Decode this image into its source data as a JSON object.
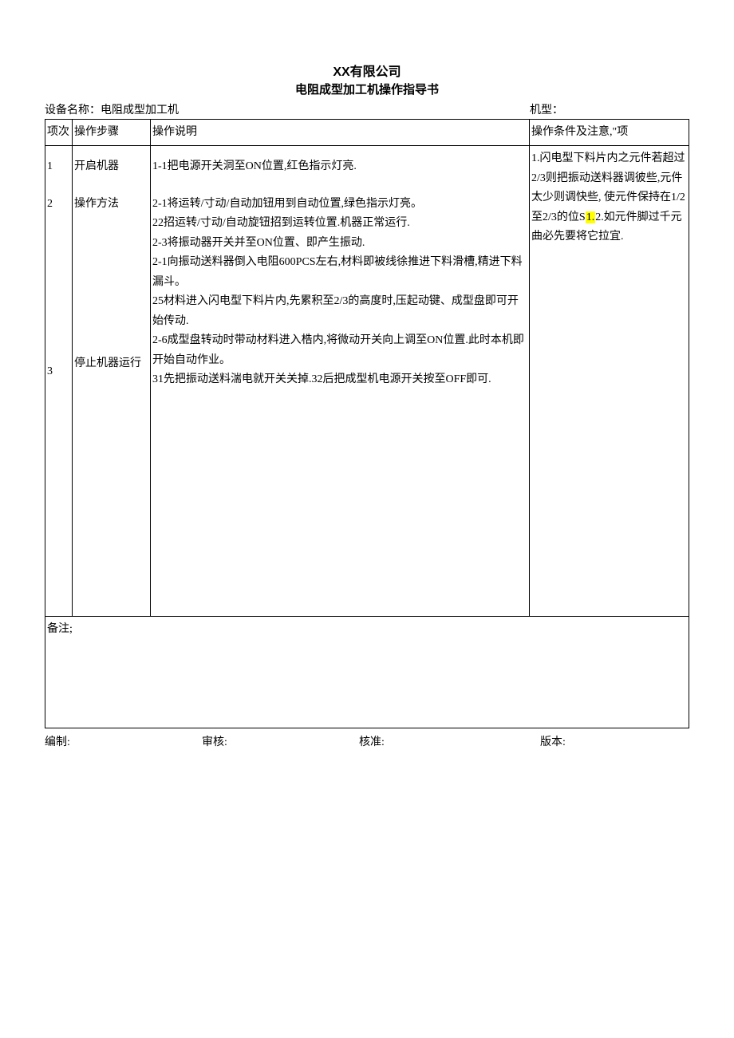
{
  "title": "XX有限公司",
  "subtitle": "电阻成型加工机操作指导书",
  "header": {
    "equip_label": "设备名称：电阻成型加工机",
    "model_label": "机型："
  },
  "columns": {
    "idx": "项次",
    "step": "操作步骤",
    "desc": "操作说明",
    "cond": "操作条件及注意,\"项"
  },
  "rows": [
    {
      "idx": "1",
      "step": "开启机器",
      "desc": "1-1把电源开关洞至ON位置,红色指示灯亮."
    },
    {
      "idx": "2",
      "step": "操作方法",
      "desc": "2-1将运转/寸动/自动加钮用到自动位置,绿色指示灯亮。\n22招运转/寸动/自动旋钮招到运转位置.机器正常运行.\n2-3将振动器开关并至ON位置、即产生振动.\n2-1向振动送料器倒入电阻600PCS左右,材料即被线徐推进下料滑槽,精进下料漏斗。\n25材料进入闪电型下料片内,先累积至2/3的高度时,压起动键、成型盘即可开始传动.\n2-6成型盘转动时带动材料进入梏内,将微动开关向上调至ON位置.此时本机即开始自动作业。"
    },
    {
      "idx": "3",
      "step": "停止机器运行",
      "desc": "31先把振动送料湍电就开关关掉.32后把成型机电源开关按至OFF即可."
    }
  ],
  "conditions": {
    "pre": " 1.闪电型下料片内之元件若超过2/3则把振动送料器调彼些,元件太少则调快些, 使元件保持在1/2至2/3的位S",
    "hl": "1.",
    "post": "2.如元件脚过千元曲必先要将它拉宜."
  },
  "remarks_label": "备注;",
  "footer": {
    "made": "编制:",
    "review": "审核:",
    "approve": "核准:",
    "version": "版本:"
  }
}
